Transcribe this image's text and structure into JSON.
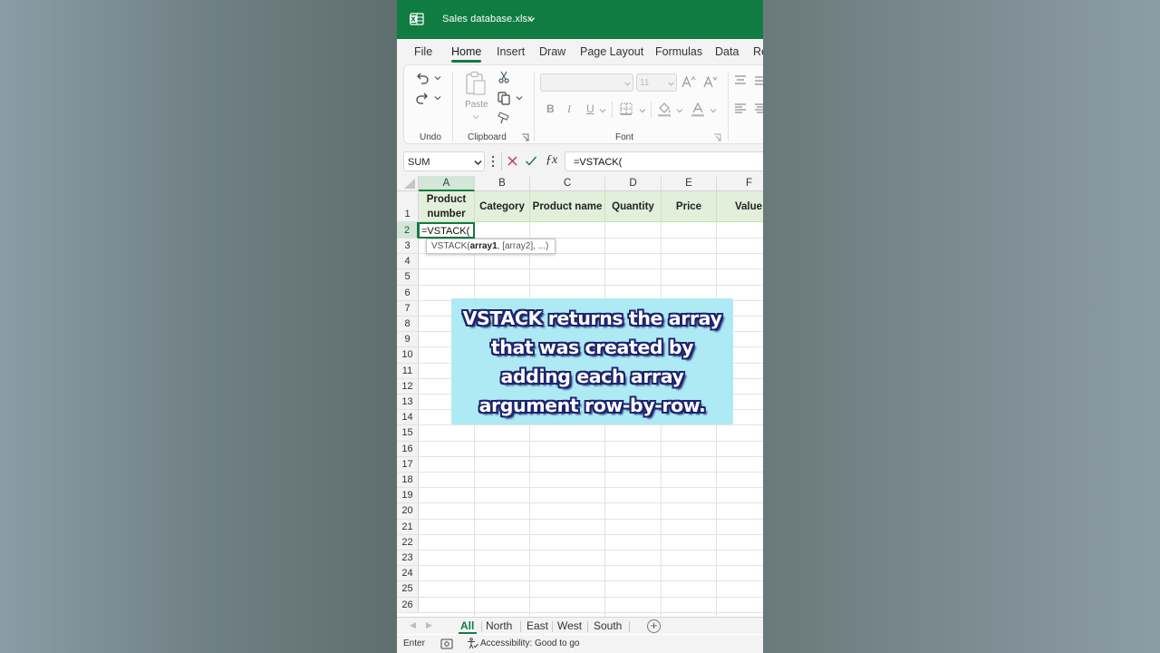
{
  "window": {
    "title": "Sales database.xlsx",
    "accent": "#107c41"
  },
  "menu": {
    "tabs": [
      "File",
      "Home",
      "Insert",
      "Draw",
      "Page Layout",
      "Formulas",
      "Data",
      "Re"
    ],
    "active": "Home"
  },
  "ribbon": {
    "undo_label": "Undo",
    "clipboard_label": "Clipboard",
    "font_label": "Font",
    "paste_label": "Paste",
    "font_size": "11",
    "bold": "B",
    "italic": "I",
    "underline": "U"
  },
  "formula_bar": {
    "name_box": "SUM",
    "formula": "=VSTACK("
  },
  "sheet": {
    "columns": [
      "A",
      "B",
      "C",
      "D",
      "E",
      "F"
    ],
    "rows": [
      "1",
      "2",
      "3",
      "4",
      "5",
      "6",
      "7",
      "8",
      "9",
      "10",
      "11",
      "12",
      "13",
      "14",
      "15",
      "16",
      "17",
      "18",
      "19",
      "20",
      "21",
      "22",
      "23",
      "24",
      "25",
      "26"
    ],
    "headers": {
      "a_line1": "Product",
      "a_line2": "number",
      "b": "Category",
      "c": "Product name",
      "d": "Quantity",
      "e": "Price",
      "f": "Value"
    },
    "active_cell_value": "=VSTACK(",
    "tooltip": {
      "fn": "VSTACK(",
      "arg1": "array1",
      "rest": ", [array2], ...)"
    }
  },
  "callout": {
    "text": "VSTACK returns the array that was created by adding each array argument row-by-row."
  },
  "sheet_tabs": {
    "tabs": [
      "All",
      "North",
      "East",
      "West",
      "South"
    ],
    "active": "All"
  },
  "status": {
    "mode": "Enter",
    "accessibility": "Accessibility: Good to go"
  }
}
